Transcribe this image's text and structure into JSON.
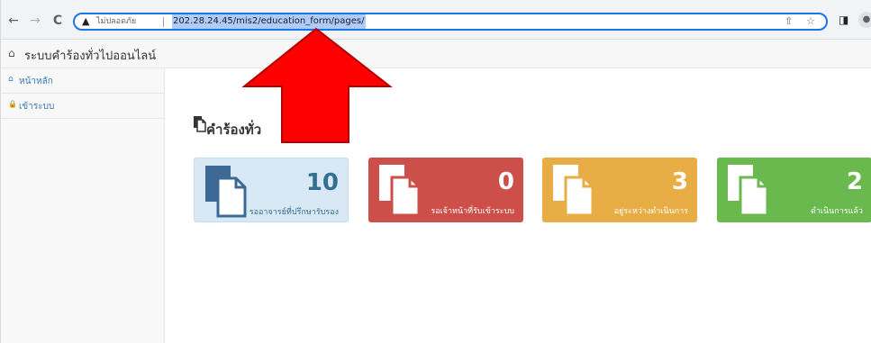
{
  "browser": {
    "back_glyph": "←",
    "forward_glyph": "→",
    "reload_glyph": "C",
    "warning_glyph": "▲",
    "security_label": "ไม่ปลอดภัย",
    "url": "202.28.24.45/mis2/education_form/pages/",
    "share_glyph": "⇧",
    "star_glyph": "☆",
    "sidepanel_glyph": "◨",
    "profile_glyph": "●"
  },
  "header": {
    "home_glyph": "⌂",
    "title": "ระบบคำร้องทั่วไปออนไลน์"
  },
  "sidebar": {
    "items": [
      {
        "glyph": "⌂",
        "label": "หน้าหลัก"
      },
      {
        "glyph": "🔒",
        "label": "เข้าระบบ"
      }
    ]
  },
  "main": {
    "title": "คำร้องทั่ว",
    "cards": [
      {
        "count": "10",
        "label": "รออาจารย์ที่ปรึกษารับรอง",
        "color": "#d9e8f5"
      },
      {
        "count": "0",
        "label": "รอเจ้าหน้าที่รับเข้าระบบ",
        "color": "#cc4f4a"
      },
      {
        "count": "3",
        "label": "อยู่ระหว่างดำเนินการ",
        "color": "#e8ae45"
      },
      {
        "count": "2",
        "label": "ดำเนินการแล้ว",
        "color": "#6ab94e"
      }
    ]
  },
  "colors": {
    "arrow": "#ff0000",
    "link": "#337ab7",
    "omnibox_focus": "#1a73e8"
  }
}
